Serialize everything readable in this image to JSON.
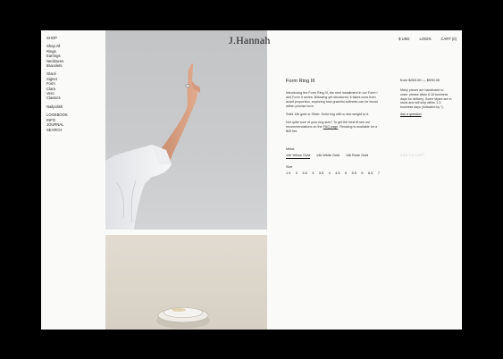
{
  "colors": {
    "background": "#000000",
    "page": "#fafaf8",
    "text": "#1c1c1c",
    "disabled": "#c7c7c7"
  },
  "brand": {
    "logo": "J.Hannah"
  },
  "header": {
    "currency": "$ USD",
    "login": "LOGIN",
    "cart": "CART (0)"
  },
  "sidebar": {
    "shop": "SHOP",
    "categories": [
      "Shop All",
      "Rings",
      "Earrings",
      "Necklaces",
      "Bracelets"
    ],
    "collections": [
      "Glacé",
      "Signet",
      "Form",
      "Clara",
      "Vero",
      "Classics"
    ],
    "nailpolish": "Nailpolish",
    "info": [
      "LOOKBOOK",
      "INFO",
      "JOURNAL",
      "SEARCH"
    ]
  },
  "product": {
    "name": "Form Ring III",
    "desc1": "Introducing the Form Ring III, the next installment in our Form I and Form II series. Billowing yet structured, it takes cues from avant proportion, exploring how graceful softness can be found within precise form.",
    "desc2": "Solid 14k gold or Silver. Solid ring with a nice weight to it.",
    "desc3_pre": "Not quite sure of your ring size? To get the best fit see our recommendations on the",
    "faq_link": "FAQ page",
    "desc3_post": ". Resizing is available for a $45 fee.",
    "metal_label": "Metal",
    "metals": [
      "14k Yellow Gold",
      "14k White Gold",
      "14k Rose Gold"
    ],
    "size_label": "Size",
    "sizes": [
      "1.0",
      "3",
      "3.5",
      "3",
      "3.5",
      "4",
      "4.5",
      "5",
      "5.5",
      "6",
      "6.5",
      "7"
    ],
    "price": "from $260.00 — $930.00",
    "ship_info": "Many pieces are handmade to order, please allow 6-10 business days for delivery. Some styles are in stock and will ship within 1-3 business days (indicated by *).",
    "ask": "Ask a question",
    "add_to_cart": "ADD TO CART"
  }
}
